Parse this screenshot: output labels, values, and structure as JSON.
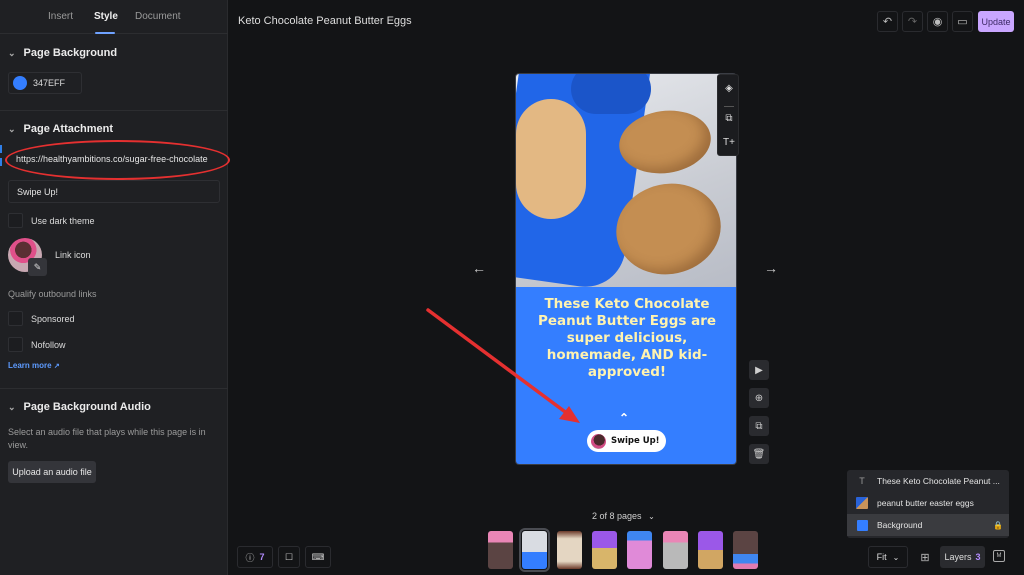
{
  "sidebar": {
    "tabs": [
      {
        "label": "Insert",
        "active": false
      },
      {
        "label": "Style",
        "active": true
      },
      {
        "label": "Document",
        "active": false
      }
    ],
    "page_background": {
      "title": "Page Background",
      "color_hex": "347EFF",
      "color_value": "#347EFF"
    },
    "page_attachment": {
      "title": "Page Attachment",
      "url": "https://healthyambitions.co/sugar-free-chocolate",
      "cta_text": "Swipe Up!",
      "dark_theme_label": "Use dark theme",
      "link_icon_label": "Link icon",
      "qualify_label": "Qualify outbound links",
      "sponsored_label": "Sponsored",
      "nofollow_label": "Nofollow",
      "learn_more": "Learn more"
    },
    "page_audio": {
      "title": "Page Background Audio",
      "description": "Select an audio file that plays while this page is in view.",
      "upload_label": "Upload an audio file"
    }
  },
  "header": {
    "title": "Keto Chocolate Peanut Butter Eggs",
    "update_label": "Update",
    "icons": [
      "undo-icon",
      "redo-icon",
      "preview-eye-icon",
      "device-checklist-icon"
    ]
  },
  "canvas": {
    "headline": "These Keto Chocolate Peanut Butter Eggs are super delicious, homemade, AND kid-approved!",
    "swipe_label": "Swipe Up!",
    "swipe_caret": "^",
    "background_color": "#347EFF"
  },
  "layers": {
    "items": [
      {
        "label": "These Keto Chocolate Peanut ...",
        "type": "text"
      },
      {
        "label": "peanut butter easter eggs",
        "type": "image"
      },
      {
        "label": "Background",
        "type": "background",
        "locked": true,
        "selected": true
      }
    ]
  },
  "footer": {
    "page_indicator": "2 of 8 pages",
    "help_count": "7",
    "zoom_label": "Fit",
    "layers_label": "Layers",
    "layers_count": "3",
    "current_page": 2,
    "total_pages": 8
  },
  "colors": {
    "accent": "#C9A6FF",
    "page_bg": "#347EFF",
    "headline_text": "#FFF3B0",
    "annotation_red": "#E53030"
  }
}
